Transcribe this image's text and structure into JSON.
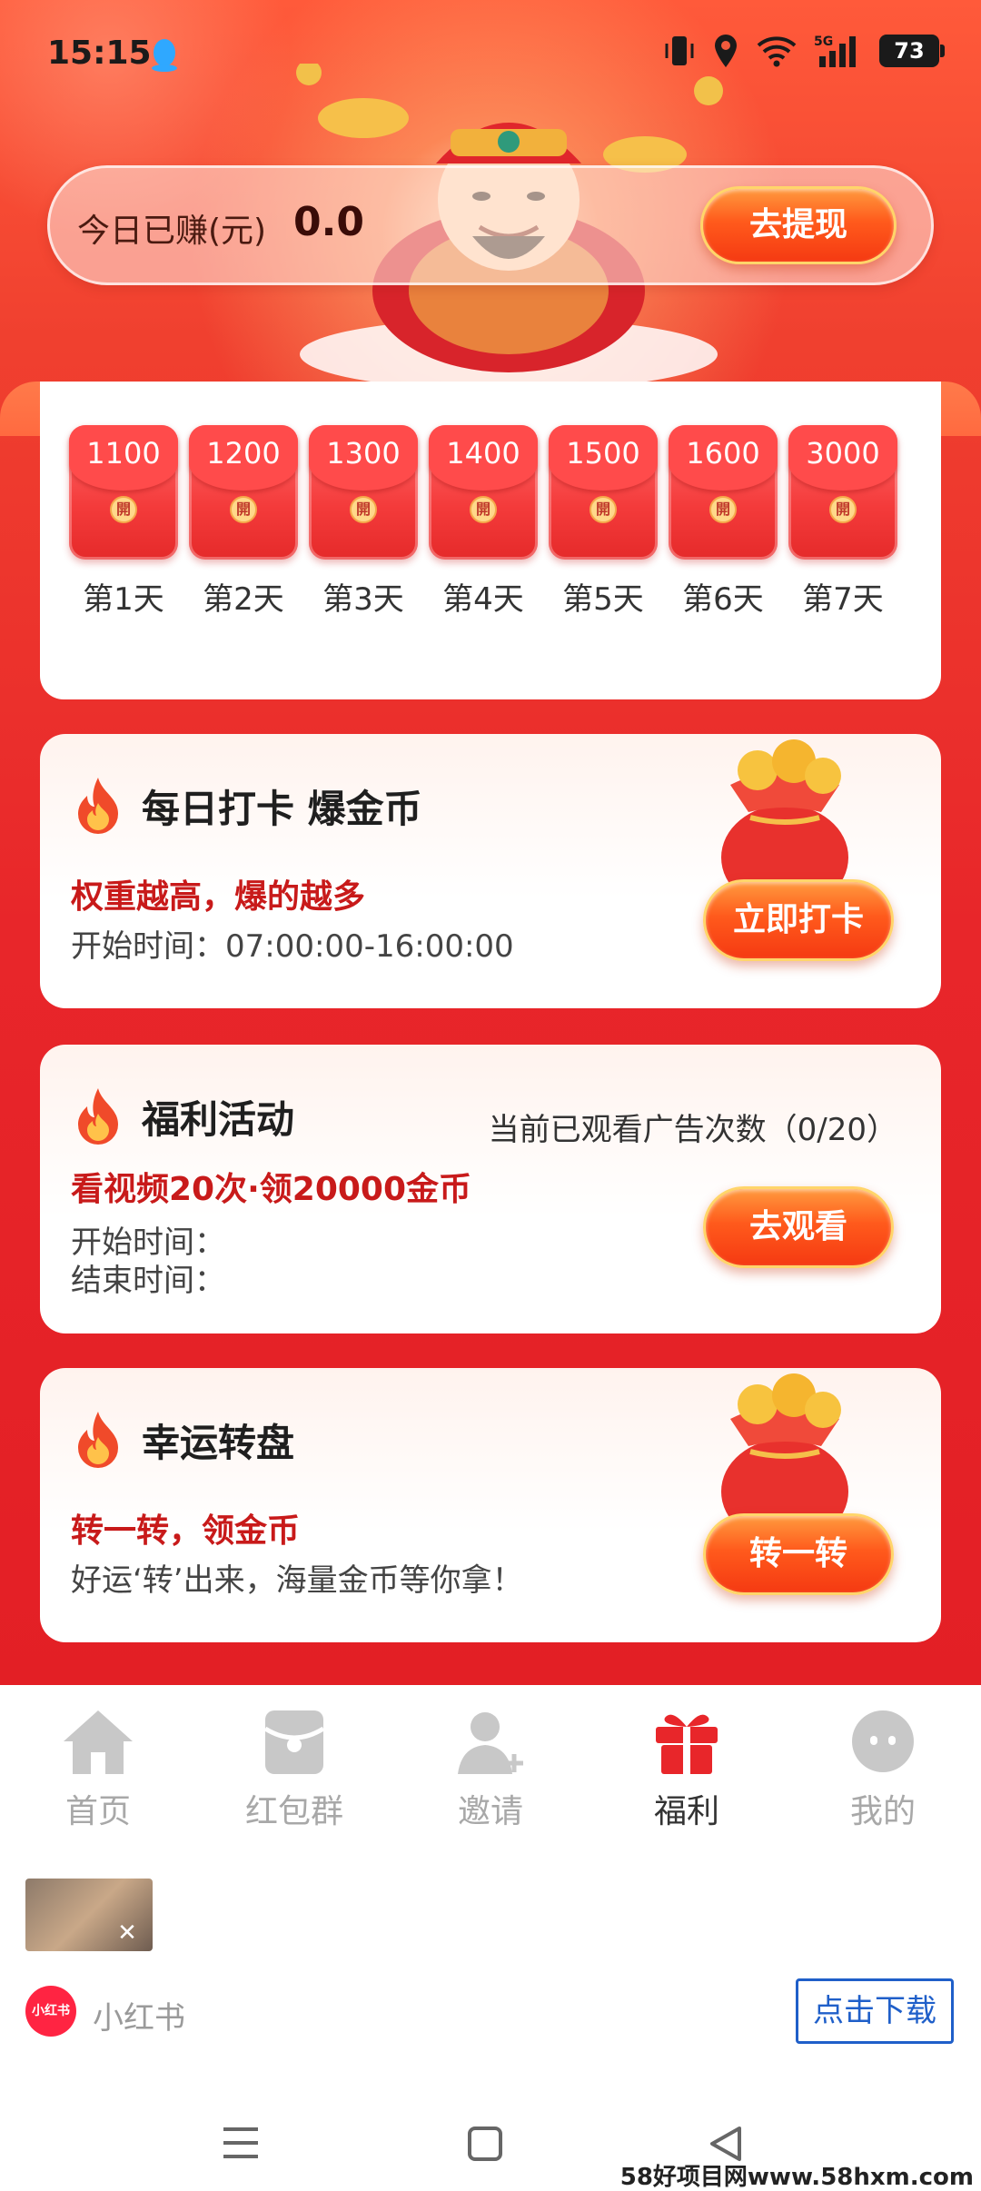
{
  "status_bar": {
    "time": "15:15",
    "battery": "73",
    "network": "5G"
  },
  "earnings": {
    "label": "今日已赚(元)",
    "value": "0.0",
    "withdraw_label": "去提现"
  },
  "signin": {
    "days": [
      {
        "amount": "1100",
        "label": "第1天"
      },
      {
        "amount": "1200",
        "label": "第2天"
      },
      {
        "amount": "1300",
        "label": "第3天"
      },
      {
        "amount": "1400",
        "label": "第4天"
      },
      {
        "amount": "1500",
        "label": "第5天"
      },
      {
        "amount": "1600",
        "label": "第6天"
      },
      {
        "amount": "3000",
        "label": "第7天"
      }
    ],
    "seal_char": "開"
  },
  "checkin": {
    "title": "每日打卡 爆金币",
    "highlight": "权重越高，爆的越多",
    "time_text": "开始时间：07:00:00-16:00:00",
    "button": "立即打卡"
  },
  "welfare": {
    "title": "福利活动",
    "ad_count": "当前已观看广告次数（0/20）",
    "highlight": "看视频20次·领20000金币",
    "start_label": "开始时间：",
    "end_label": "结束时间：",
    "button": "去观看"
  },
  "lucky": {
    "title": "幸运转盘",
    "highlight": "转一转，领金币",
    "sub": "好运‘转’出来，海量金币等你拿！",
    "button": "转一转"
  },
  "tabs": [
    {
      "label": "首页",
      "icon": "home-icon",
      "active": false
    },
    {
      "label": "红包群",
      "icon": "red-packet-icon",
      "active": false
    },
    {
      "label": "邀请",
      "icon": "invite-icon",
      "active": false
    },
    {
      "label": "福利",
      "icon": "gift-icon",
      "active": true
    },
    {
      "label": "我的",
      "icon": "profile-icon",
      "active": false
    }
  ],
  "ad": {
    "logo_text": "小红书",
    "app_name": "小红书",
    "download_label": "点击下载"
  },
  "watermark": "58好项目网www.58hxm.com",
  "colors": {
    "brand_red": "#e31f25",
    "button_orange": "#ff5a1c",
    "highlight_red": "#c81a1a",
    "active_tab": "#e8262a",
    "download_blue": "#1f5fc9"
  }
}
